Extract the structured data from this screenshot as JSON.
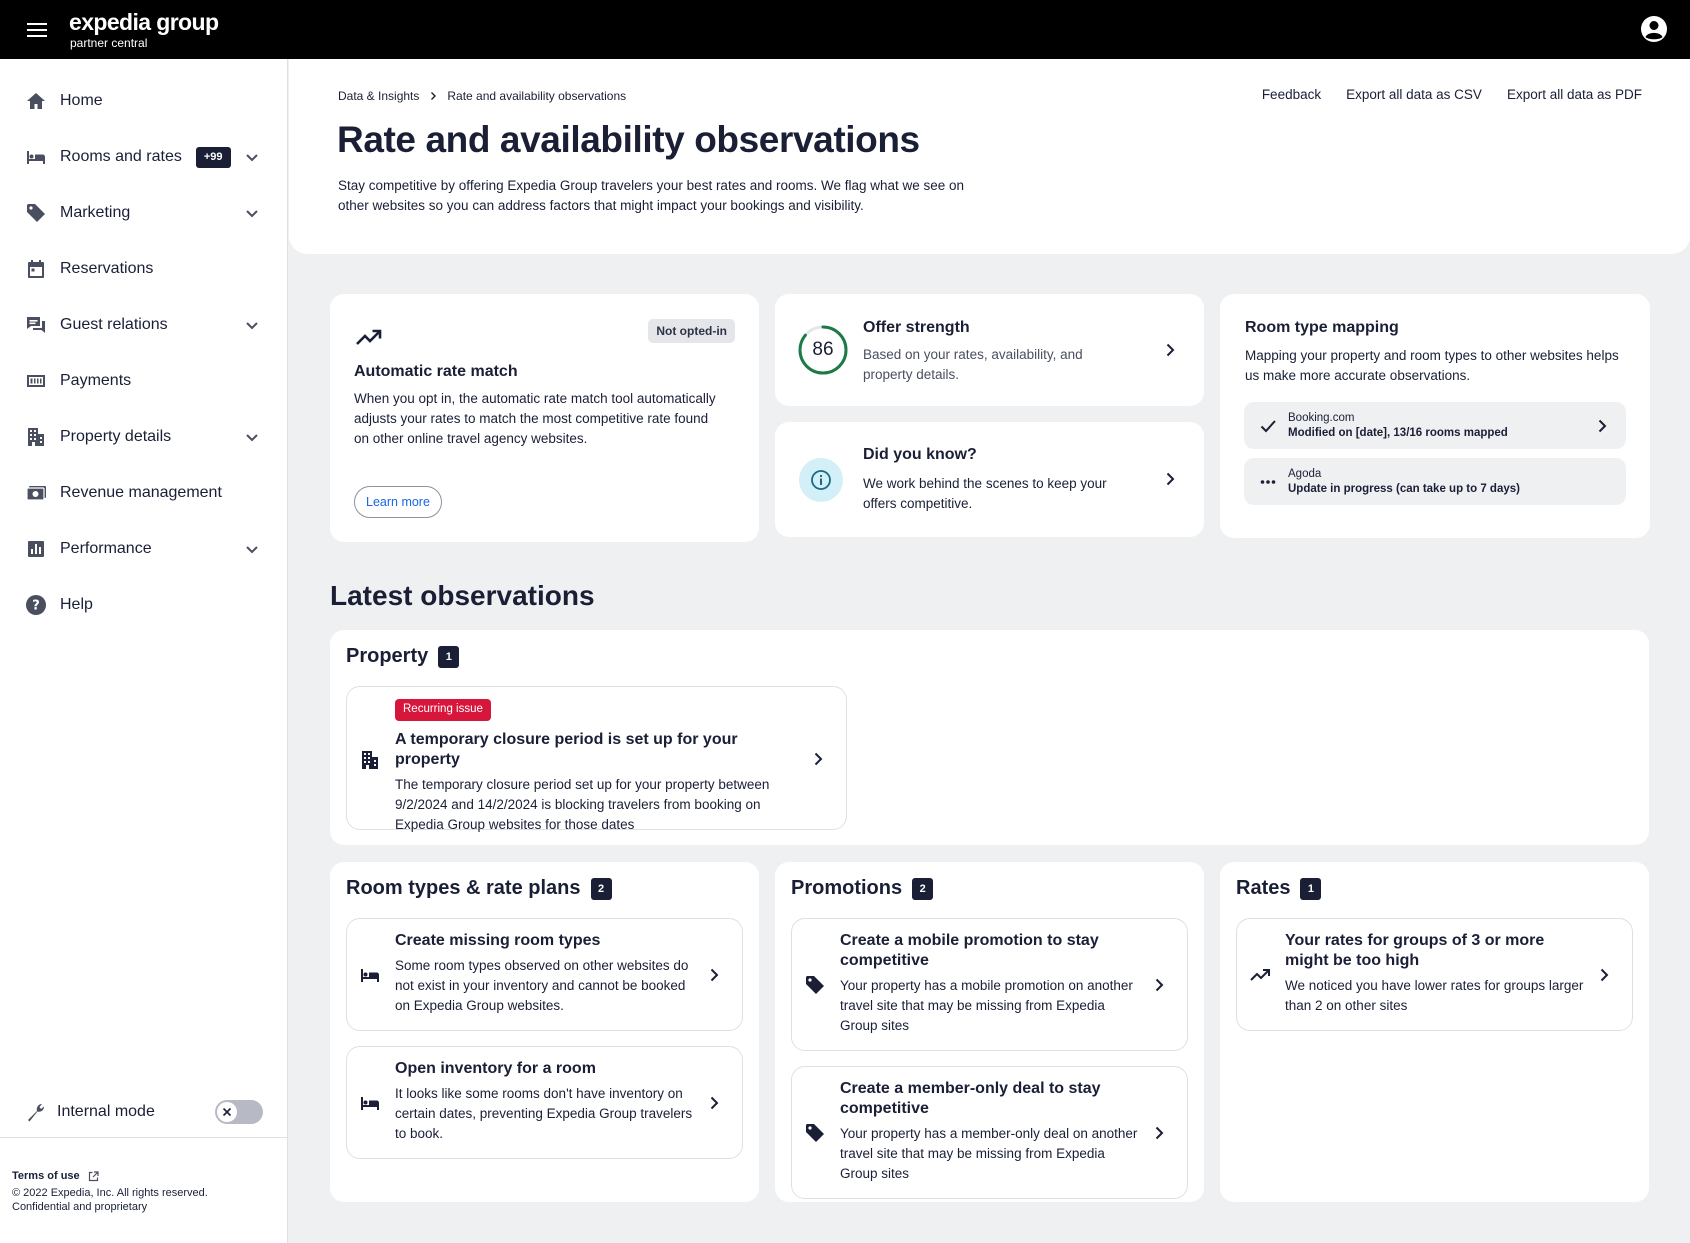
{
  "brand": {
    "name": "expedia group",
    "tagline": "partner central"
  },
  "sidebar": {
    "items": [
      {
        "label": "Home",
        "icon": "home-icon"
      },
      {
        "label": "Rooms and rates",
        "icon": "bed-icon",
        "badge": "+99",
        "expandable": true
      },
      {
        "label": "Marketing",
        "icon": "tag-icon",
        "expandable": true
      },
      {
        "label": "Reservations",
        "icon": "calendar-icon"
      },
      {
        "label": "Guest relations",
        "icon": "chat-icon",
        "expandable": true
      },
      {
        "label": "Payments",
        "icon": "payments-icon"
      },
      {
        "label": "Property details",
        "icon": "building-icon",
        "expandable": true
      },
      {
        "label": "Revenue management",
        "icon": "revenue-icon"
      },
      {
        "label": "Performance",
        "icon": "chart-icon",
        "expandable": true
      },
      {
        "label": "Help",
        "icon": "help-icon"
      }
    ],
    "internal_mode": {
      "label": "Internal mode",
      "enabled": false
    },
    "footer": {
      "terms": "Terms of use",
      "copyright": "© 2022 Expedia, Inc. All rights reserved.",
      "confidential": "Confidential and proprietary"
    }
  },
  "header": {
    "breadcrumb": [
      "Data & Insights",
      "Rate and availability observations"
    ],
    "actions": [
      "Feedback",
      "Export all data as CSV",
      "Export all data as PDF"
    ],
    "title": "Rate and availability observations",
    "description": "Stay competitive by offering Expedia Group travelers your best rates and rooms. We flag what we see on other websites so you can address factors that might impact your bookings and visibility."
  },
  "auto_rate_match": {
    "status": "Not opted-in",
    "title": "Automatic rate match",
    "body": "When you opt in, the automatic rate match tool automatically adjusts your rates to match the most competitive rate found on other online travel agency websites.",
    "button": "Learn more"
  },
  "offer_strength": {
    "score": "86",
    "score_value": 86,
    "title": "Offer strength",
    "body": "Based on your rates, availability, and property details."
  },
  "did_you_know": {
    "title": "Did you know?",
    "body": "We work behind the scenes to keep your offers competitive."
  },
  "room_type_mapping": {
    "title": "Room type mapping",
    "body": "Mapping your property and room types to other websites helps us make more accurate observations.",
    "sites": [
      {
        "name": "Booking.com",
        "status": "Modified on [date], 13/16 rooms mapped",
        "icon": "check-icon"
      },
      {
        "name": "Agoda",
        "status": "Update in progress (can take up to 7 days)",
        "icon": "more-icon"
      }
    ]
  },
  "latest": {
    "title": "Latest observations",
    "property": {
      "title": "Property",
      "count": "1",
      "items": [
        {
          "tag": "Recurring issue",
          "title": "A temporary closure period is set up for your property",
          "body": "The temporary closure period set up for your property between 9/2/2024 and 14/2/2024 is blocking travelers from booking on Expedia Group websites for those dates"
        }
      ]
    },
    "room_types": {
      "title": "Room types & rate plans",
      "count": "2",
      "items": [
        {
          "title": "Create missing room types",
          "body": "Some room types observed on other websites do not exist in your inventory and cannot be booked on Expedia Group websites."
        },
        {
          "title": "Open inventory for a room",
          "body": "It looks like some rooms don't have inventory on certain dates, preventing Expedia Group travelers to book."
        }
      ]
    },
    "promotions": {
      "title": "Promotions",
      "count": "2",
      "items": [
        {
          "title": "Create a mobile promotion to stay competitive",
          "body": "Your property has a mobile promotion on another travel site that may be missing from Expedia Group sites"
        },
        {
          "title": "Create a member-only deal to stay competitive",
          "body": "Your property has a member-only deal on another travel site that may be missing from Expedia Group sites"
        }
      ]
    },
    "rates": {
      "title": "Rates",
      "count": "1",
      "items": [
        {
          "title": "Your rates for groups of 3 or more might be too high",
          "body": "We noticed you have lower rates for groups larger than 2 on other sites"
        }
      ]
    }
  },
  "colors": {
    "accent": "#1668e3",
    "score_ring": "#1c7a45",
    "alert": "#d7163b",
    "navy": "#1a1f36",
    "info_bg": "#d3eff7"
  }
}
